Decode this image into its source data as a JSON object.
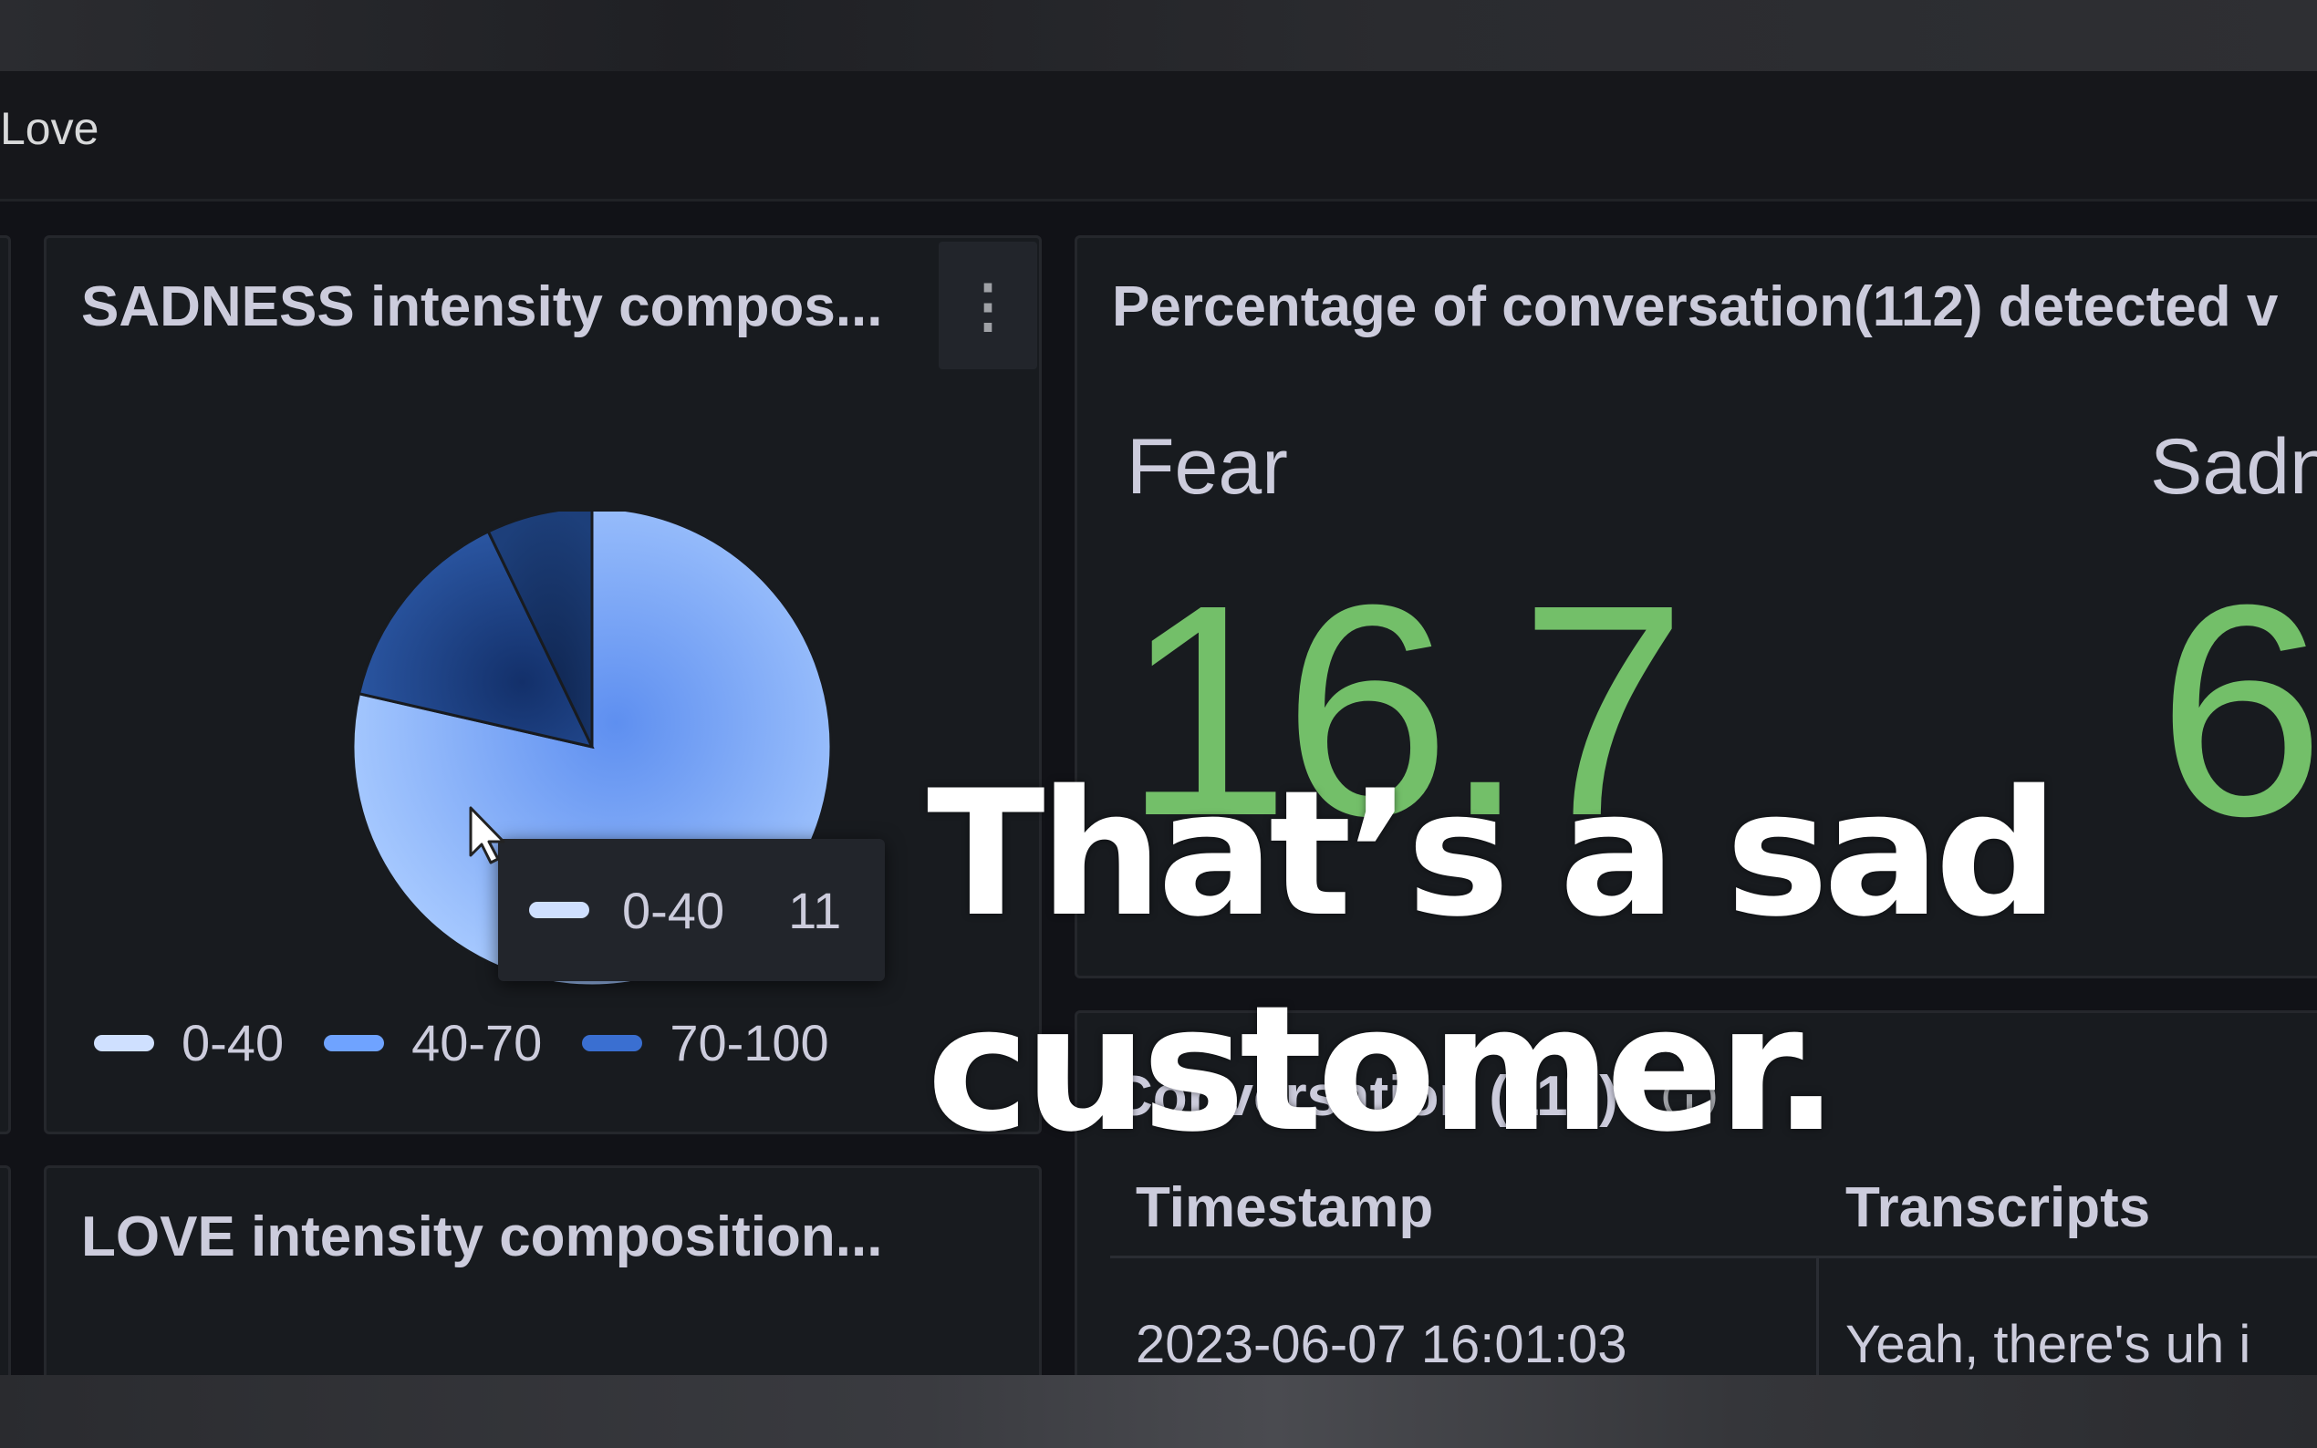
{
  "row": {
    "title": "Love"
  },
  "sadness_panel": {
    "title": "SADNESS intensity compos...",
    "menu_icon": "⋮",
    "legend": [
      {
        "label": "0-40",
        "color": "#cfe0ff"
      },
      {
        "label": "40-70",
        "color": "#6fa3ff"
      },
      {
        "label": "70-100",
        "color": "#3a6fd1"
      }
    ],
    "tooltip": {
      "label": "0-40",
      "value": "11",
      "color": "#cfe0ff"
    }
  },
  "chart_data": {
    "type": "pie",
    "title": "SADNESS intensity compos...",
    "categories": [
      "0-40",
      "40-70",
      "70-100"
    ],
    "values": [
      11,
      2,
      1
    ],
    "colors": [
      "#8fb8ff",
      "#1e3f7a",
      "#163264"
    ]
  },
  "stat_panel": {
    "title": "Percentage of conversation(112) detected v",
    "stats": [
      {
        "label": "Fear",
        "value": "16.7"
      },
      {
        "label": "Sadn",
        "value": "6"
      }
    ]
  },
  "love_panel": {
    "title": "LOVE intensity composition..."
  },
  "conversation_panel": {
    "title": "Conversation (112)",
    "columns": [
      "Timestamp",
      "Transcripts"
    ],
    "rows": [
      {
        "timestamp": "2023-06-07 16:01:03",
        "transcript": "Yeah, there's uh i"
      }
    ]
  },
  "caption": {
    "line1": "That’s a sad",
    "line2": "customer."
  },
  "colors": {
    "value_green": "#73bf69",
    "panel_bg": "#181b1f"
  }
}
